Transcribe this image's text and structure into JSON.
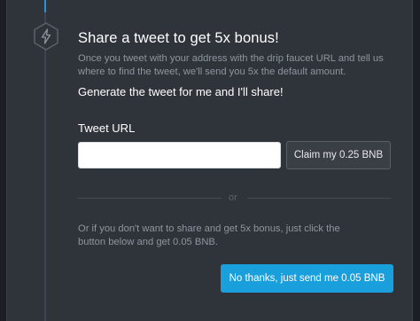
{
  "step": {
    "title": "Share a tweet to get 5x bonus!",
    "description": "Once you tweet with your address with the drip faucet URL and tell us where to find the tweet, we'll send you 5x the default amount.",
    "generate_link": "Generate the tweet for me and I'll share!",
    "url_label": "Tweet URL",
    "url_value": "",
    "url_placeholder": "",
    "claim_button": "Claim my 0.25 BNB",
    "divider_text": "or",
    "alt_description": "Or if you don't want to share and get 5x bonus, just click the button below and get 0.05 BNB.",
    "no_thanks_button": "No thanks, just send me 0.05 BNB",
    "icon": "lightning-icon"
  },
  "colors": {
    "card_bg": "#2f343b",
    "page_bg": "#1b1f25",
    "accent": "#199fdc",
    "text_primary": "#ffffff",
    "text_muted": "#8e959e"
  }
}
